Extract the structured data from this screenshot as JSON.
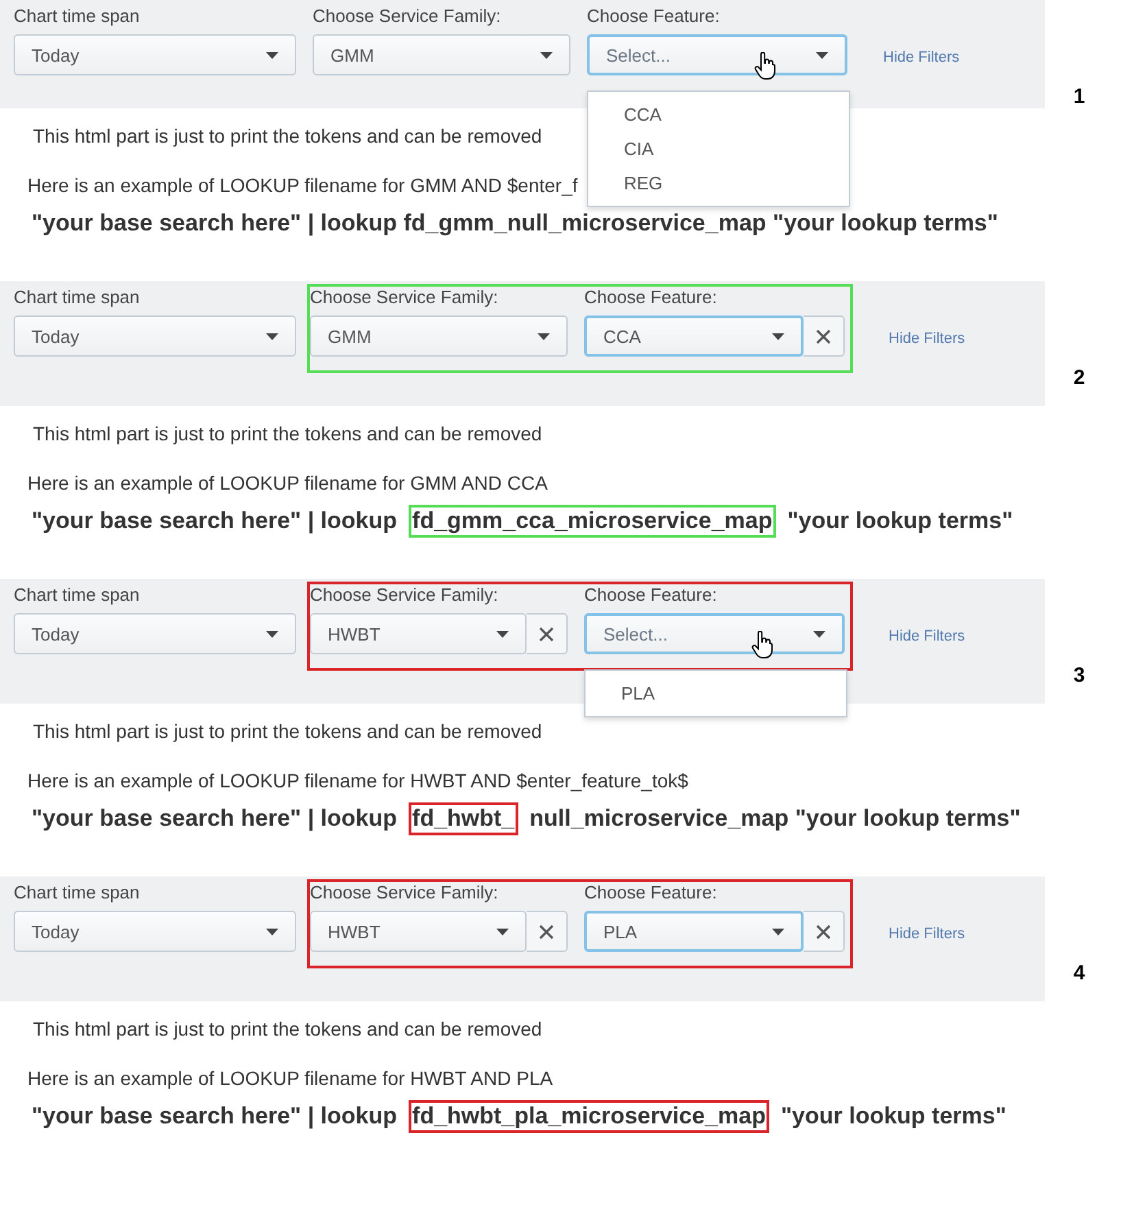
{
  "panels": [
    {
      "number": "1",
      "filters_framed": false,
      "time_span": {
        "label": "Chart time span",
        "value": "Today"
      },
      "service_family": {
        "label": "Choose Service Family:",
        "value": "GMM",
        "clearable": false
      },
      "feature": {
        "label": "Choose Feature:",
        "placeholder": "Select...",
        "focused": true,
        "clearable": false,
        "expanded": true,
        "options": [
          "CCA",
          "CIA",
          "REG"
        ]
      },
      "hide_filters": "Hide Filters",
      "info": "This html part is just to print the tokens and can be removed",
      "example": "Here is an example of LOOKUP filename for GMM AND $enter_f",
      "query": [
        {
          "text": "\"your base search here\" | lookup fd_gmm_null_microservice_map \"your lookup terms\"",
          "highlighted": false
        }
      ]
    },
    {
      "number": "2",
      "color": "#55dd55",
      "filters_framed": true,
      "time_span": {
        "label": "Chart time span",
        "value": "Today"
      },
      "service_family": {
        "label": "Choose Service Family:",
        "value": "GMM",
        "clearable": false
      },
      "feature": {
        "label": "Choose Feature:",
        "value": "CCA",
        "focused": true,
        "clearable": true,
        "expanded": false
      },
      "hide_filters": "Hide Filters",
      "info": "This html part is just to print the tokens and can be removed",
      "example": "Here is an example of LOOKUP filename for GMM AND CCA",
      "query": [
        {
          "text": "\"your base search here\" | lookup",
          "highlighted": false
        },
        {
          "text": "fd_gmm_cca_microservice_map",
          "highlighted": true
        },
        {
          "text": "\"your lookup terms\"",
          "highlighted": false
        }
      ]
    },
    {
      "number": "3",
      "color": "#d9252a",
      "filters_framed": true,
      "time_span": {
        "label": "Chart time span",
        "value": "Today"
      },
      "service_family": {
        "label": "Choose Service Family:",
        "value": "HWBT",
        "clearable": true
      },
      "feature": {
        "label": "Choose Feature:",
        "placeholder": "Select...",
        "focused": true,
        "clearable": false,
        "expanded": true,
        "options": [
          "PLA"
        ]
      },
      "hide_filters": "Hide Filters",
      "info": "This html part is just to print the tokens and can be removed",
      "example": "Here is an example of LOOKUP filename for HWBT AND $enter_feature_tok$",
      "query": [
        {
          "text": "\"your base search here\" | lookup",
          "highlighted": false
        },
        {
          "text": "fd_hwbt_",
          "highlighted": true
        },
        {
          "text": "null_microservice_map \"your lookup terms\"",
          "highlighted": false
        }
      ]
    },
    {
      "number": "4",
      "color": "#d9252a",
      "filters_framed": true,
      "time_span": {
        "label": "Chart time span",
        "value": "Today"
      },
      "service_family": {
        "label": "Choose Service Family:",
        "value": "HWBT",
        "clearable": true
      },
      "feature": {
        "label": "Choose Feature:",
        "value": "PLA",
        "focused": true,
        "clearable": true,
        "expanded": false
      },
      "hide_filters": "Hide Filters",
      "info": "This html part is just to print the tokens and can be removed",
      "example": "Here is an example of LOOKUP filename for HWBT AND PLA",
      "query": [
        {
          "text": "\"your base search here\" | lookup",
          "highlighted": false
        },
        {
          "text": "fd_hwbt_pla_microservice_map",
          "highlighted": true
        },
        {
          "text": "\"your lookup terms\"",
          "highlighted": false
        }
      ]
    }
  ]
}
